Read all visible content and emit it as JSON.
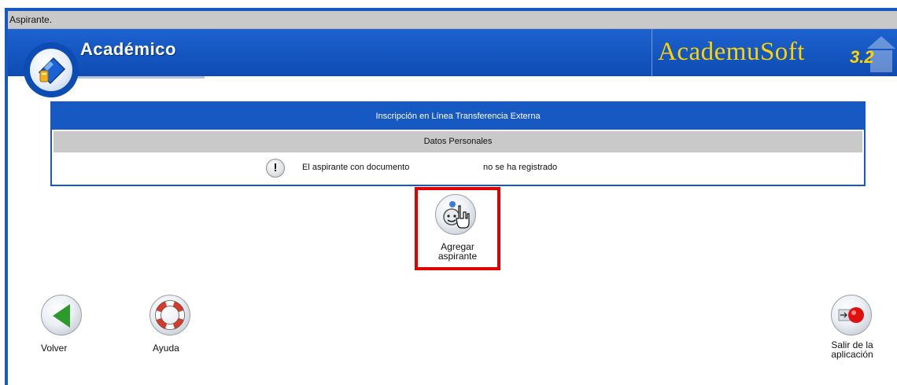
{
  "breadcrumb": "Aspirante.",
  "header": {
    "title": "Académico",
    "brand": "AcademuSoft",
    "brand_version": "3.2"
  },
  "panel": {
    "title": "Inscripción en Línea Transferencia Externa",
    "subtitle": "Datos Personales",
    "message_part1": "El aspirante con documento",
    "message_part2": "no se ha registrado",
    "message_icon": "exclamation-icon"
  },
  "actions": {
    "add_applicant_line1": "Agregar",
    "add_applicant_line2": "aspirante",
    "back": "Volver",
    "help": "Ayuda",
    "exit_line1": "Salir de la",
    "exit_line2": "aplicación"
  },
  "colors": {
    "primary_blue": "#1659c2",
    "gray_bar": "#c9c9c9",
    "brand_yellow": "#ffd200",
    "highlight_red": "#e00000",
    "back_green": "#2d9a2d"
  }
}
